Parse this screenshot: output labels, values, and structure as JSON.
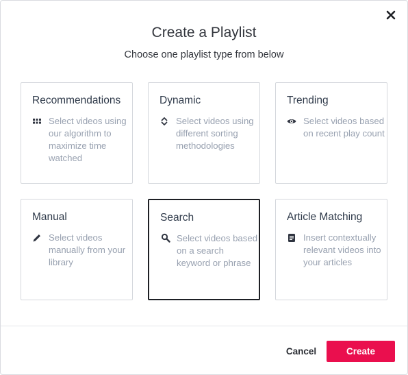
{
  "modal": {
    "title": "Create a Playlist",
    "subtitle": "Choose one playlist type from below",
    "close_icon": "close-icon"
  },
  "cards": [
    {
      "title": "Recommendations",
      "icon": "grid-icon",
      "description": "Select videos using our algorithm to maximize time watched",
      "selected": false
    },
    {
      "title": "Dynamic",
      "icon": "sort-icon",
      "description": "Select videos using different sorting methodologies",
      "selected": false
    },
    {
      "title": "Trending",
      "icon": "eye-icon",
      "description": "Select videos based on recent play count",
      "selected": false
    },
    {
      "title": "Manual",
      "icon": "pencil-icon",
      "description": "Select videos manually from your library",
      "selected": false
    },
    {
      "title": "Search",
      "icon": "search-icon",
      "description": "Select videos based on a search keyword or phrase",
      "selected": true
    },
    {
      "title": "Article Matching",
      "icon": "document-icon",
      "description": "Insert contextually relevant videos into your articles",
      "selected": false
    }
  ],
  "footer": {
    "cancel_label": "Cancel",
    "create_label": "Create"
  },
  "colors": {
    "accent": "#ea0f4e",
    "title_text": "#33363d",
    "description_text": "#98a1b0",
    "card_border": "#d4d7dc",
    "selected_border": "#1d1f24"
  }
}
